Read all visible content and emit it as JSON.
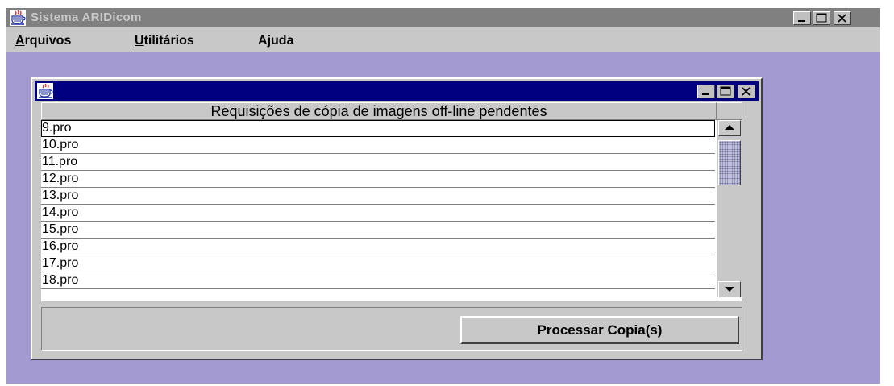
{
  "window": {
    "title": "Sistema ARIDicom",
    "controls": [
      "minimize",
      "maximize",
      "close"
    ]
  },
  "menu": [
    {
      "mnemonic": "A",
      "rest": "rquivos"
    },
    {
      "mnemonic": "U",
      "rest": "tilitários"
    },
    {
      "pre": "A",
      "mnemonic": "j",
      "rest": "uda"
    }
  ],
  "internal_frame": {
    "controls": [
      "minimize",
      "maximize",
      "close"
    ],
    "table": {
      "header": "Requisições de cópia de imagens off-line pendentes",
      "rows": [
        "9.pro",
        "10.pro",
        "11.pro",
        "12.pro",
        "13.pro",
        "14.pro",
        "15.pro",
        "16.pro",
        "17.pro",
        "18.pro"
      ]
    },
    "button_label": "Processar Copia(s)"
  },
  "colors": {
    "desktop": "#a29ad0",
    "inactive_title": "#808080",
    "active_title": "#000080",
    "panel": "#c8c8c8"
  }
}
